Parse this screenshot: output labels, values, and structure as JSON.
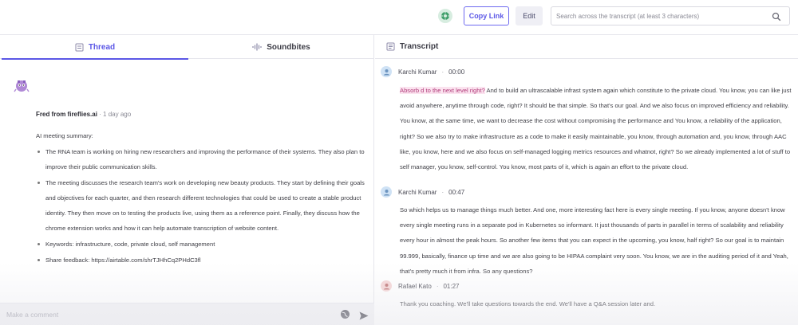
{
  "toolbar": {
    "copy_link_label": "Copy Link",
    "edit_label": "Edit",
    "search_placeholder": "Search across the transcript (at least 3 characters)",
    "icons": [
      "gear-icon",
      "search-icon"
    ],
    "accent_color": "#5b57e6"
  },
  "left": {
    "tabs": [
      {
        "label": "Thread",
        "icon": "notes-icon",
        "active": true
      },
      {
        "label": "Soundbites",
        "icon": "soundwave-icon",
        "active": false
      }
    ],
    "message": {
      "author": "Fred from fireflies.ai",
      "time": "1 day ago",
      "intro": "AI meeting summary:",
      "bullets": [
        "The RNA team is working on hiring new researchers and improving the performance of their systems. They also plan to improve their public communication skills.",
        "The meeting discusses the research team's work on developing new beauty products. They start by defining their goals and objectives for each quarter, and then research different technologies that could be used to create a stable product identity. They then move on to testing the products live, using them as a reference point. Finally, they discuss how the chrome extension works and how it can help automate transcription of website content.",
        "Keywords: infrastructure, code, private cloud, self management",
        "Share feedback: https://airtable.com/shrTJHhCq2PHdC3fl"
      ]
    },
    "comment": {
      "placeholder": "Make a comment"
    }
  },
  "transcript": {
    "title": "Transcript",
    "segments": [
      {
        "speaker": "Karchi Kumar",
        "time": "00:00",
        "avatar_color": "#cfe2f5",
        "highlight": "Absorb d to the next level right?",
        "text": " And to build an ultrascalable infrast system again which constitute to the private cloud. You know, you can like just avoid anywhere, anytime through code, right? It should be that simple. So that's our goal. And we also focus on improved efficiency and reliability. You know, at the same time, we want to decrease the cost without compromising the performance and You know, a reliability of the application, right? So we also try to make infrastructure as a code to make it easily maintainable, you know, through automation and, you know, through AAC like, you know, here and we also focus on self-managed logging metrics resources and whatnot, right? So we already implemented a lot of stuff to self manager, you know, self-control. You know, most parts of it, which is again an effort to the private cloud."
      },
      {
        "speaker": "Karchi Kumar",
        "time": "00:47",
        "avatar_color": "#cfe2f5",
        "highlight": "",
        "text": "So which helps us to manage things much better. And one, more interesting fact here is every single meeting. If you know, anyone doesn't know every single meeting runs in a separate pod in Kubernetes so informant. It just thousands of parts in parallel in terms of scalability and reliability every hour in almost the peak hours. So another few items that you can expect in the upcoming, you know, half right? So our goal is to maintain 99.999, basically, finance up time and we are also going to be HIPAA complaint very soon. You know, we are in the auditing period of it and Yeah, that's pretty much it from infra. So any questions?"
      },
      {
        "speaker": "Rafael Kato",
        "time": "01:27",
        "avatar_color": "#f5d5d5",
        "highlight": "",
        "text": "Thank you coaching. We'll take questions towards the end. We'll have a Q&A session later and."
      }
    ]
  }
}
